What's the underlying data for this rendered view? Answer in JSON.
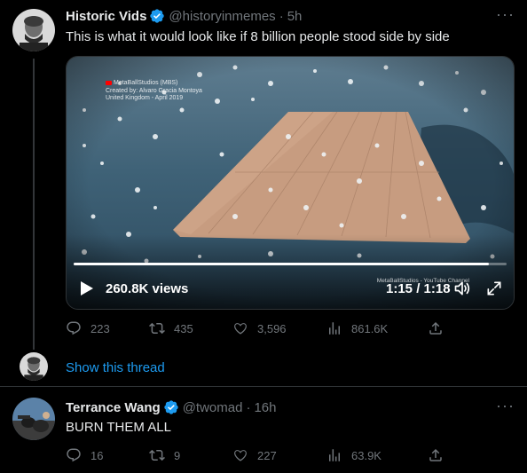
{
  "tweet1": {
    "name": "Historic Vids",
    "handle": "@historyinmemes",
    "dot": "·",
    "time": "5h",
    "more": "···",
    "text": "This is what it would look like if 8 billion people stood side by side",
    "video": {
      "watermark_lines": [
        "MetaBallStudios (MBS)",
        "Created by: Alvaro Gracia Montoya",
        "United Kingdom - April 2019"
      ],
      "watermark_br": "MetaBallStudios - YouTube Channel",
      "views": "260.8K views",
      "time": "1:15 / 1:18",
      "progress": 0.96
    },
    "actions": {
      "replies": "223",
      "retweets": "435",
      "likes": "3,596",
      "views": "861.6K"
    }
  },
  "thread": {
    "show_thread": "Show this thread"
  },
  "tweet2": {
    "name": "Terrance Wang",
    "handle": "@twomad",
    "dot": "·",
    "time": "16h",
    "more": "···",
    "text": "BURN THEM ALL",
    "actions": {
      "replies": "16",
      "retweets": "9",
      "likes": "227",
      "views": "63.9K"
    }
  },
  "colors": {
    "background": "#000000",
    "text": "#e7e9ea",
    "muted": "#71767b",
    "accent": "#1d9bf0",
    "border": "#2f3336"
  },
  "icons": [
    "verified-badge-icon",
    "reply-icon",
    "retweet-icon",
    "like-icon",
    "views-icon",
    "share-icon",
    "play-icon",
    "volume-icon",
    "fullscreen-icon",
    "more-icon"
  ]
}
